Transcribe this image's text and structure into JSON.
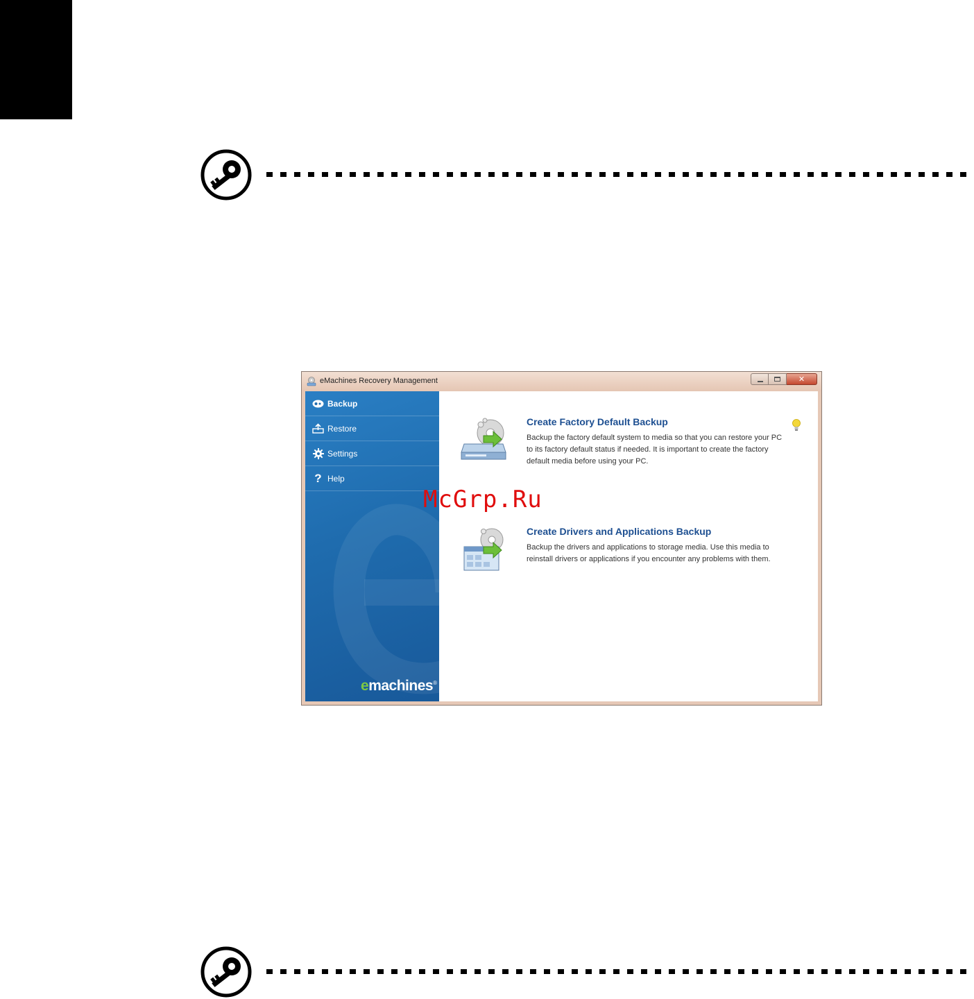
{
  "watermark": "McGrp.Ru",
  "window": {
    "title": "eMachines Recovery Management",
    "buttons": {
      "close_glyph": "✕"
    }
  },
  "sidebar": {
    "items": [
      {
        "label": "Backup",
        "icon": "disc-icon",
        "active": true
      },
      {
        "label": "Restore",
        "icon": "restore-icon",
        "active": false
      },
      {
        "label": "Settings",
        "icon": "gear-icon",
        "active": false
      },
      {
        "label": "Help",
        "icon": "question-icon",
        "active": false
      }
    ],
    "logo": {
      "prefix": "e",
      "text": "machines",
      "mark": "®"
    }
  },
  "main": {
    "options": [
      {
        "title": "Create Factory Default Backup",
        "description": "Backup the factory default system to media so that you can restore your PC to its factory default status if needed. It is important to create the factory default media before using  your PC.",
        "icon": "factory-backup-icon"
      },
      {
        "title": "Create Drivers and Applications Backup",
        "description": "Backup the drivers and applications to storage media. Use this media to reinstall drivers or applications if you encounter any problems with them.",
        "icon": "drivers-backup-icon"
      }
    ],
    "tip_icon": "lightbulb-icon"
  },
  "colors": {
    "accent": "#1d4f91",
    "sidebar": "#1f6cae",
    "logo_e": "#7dc943",
    "watermark": "#e00d0d"
  }
}
